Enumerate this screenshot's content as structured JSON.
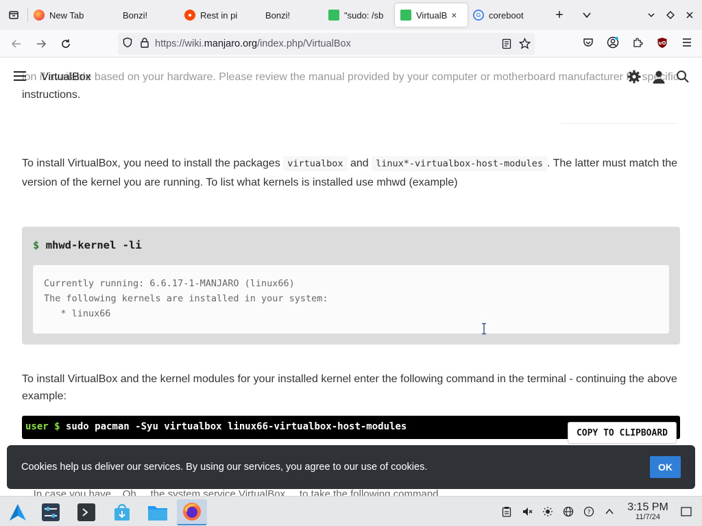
{
  "browser": {
    "tabs": [
      {
        "label": "New Tab",
        "favicon": "firefox-icon"
      },
      {
        "label": "Bonzi!",
        "favicon": "none"
      },
      {
        "label": "Rest in pi",
        "favicon": "reddit-icon"
      },
      {
        "label": "Bonzi!",
        "favicon": "none"
      },
      {
        "label": "\"sudo: /sb",
        "favicon": "manjaro-icon"
      },
      {
        "label": "VirtualB",
        "favicon": "manjaro-icon",
        "active": true,
        "close": "×"
      },
      {
        "label": "coreboot",
        "favicon": "google-icon"
      }
    ],
    "new_tab_glyph": "+",
    "url": {
      "prefix": "https://wiki.",
      "host": "manjaro.org",
      "path": "/index.php/VirtualBox"
    }
  },
  "wiki": {
    "title": "VirtualBox",
    "faded_line1": "ion if available based on your hardware. Please review the manual provided by your computer or motherboard manufacturer for specific",
    "faded_line2": "instructions.",
    "para1": {
      "t1": "To install VirtualBox, you need to install the packages ",
      "code1": "virtualbox",
      "t2": " and ",
      "code2": "linux*-virtualbox-host-modules",
      "t3": ". The latter must match the version of the kernel you are running. To list what kernels is installed use mhwd (example)"
    },
    "command": {
      "prompt": "$",
      "text": "mhwd-kernel -li"
    },
    "output": "Currently running: 6.6.17-1-MANJARO (linux66)\nThe following kernels are installed in your system:\n   * linux66",
    "para2": "To install VirtualBox and the kernel modules for your installed kernel enter the following command in the terminal - continuing the above example:",
    "terminal": {
      "user": "user $",
      "command": " sudo pacman -Syu virtualbox linux66-virtualbox-host-modules",
      "copy_label": "COPY TO CLIPBOARD"
    },
    "cut_line": "... In case you have ...Oh ... the system service VirtualBox ... to take the following command"
  },
  "cookie": {
    "text": "Cookies help us deliver our services. By using our services, you agree to our use of cookies.",
    "ok_label": "OK"
  },
  "taskbar": {
    "time": "3:15 PM",
    "date": "11/7/24"
  },
  "colors": {
    "accent": "#2f7ed8",
    "manjaro": "#35bf5c",
    "terminal_user": "#8ae234"
  }
}
